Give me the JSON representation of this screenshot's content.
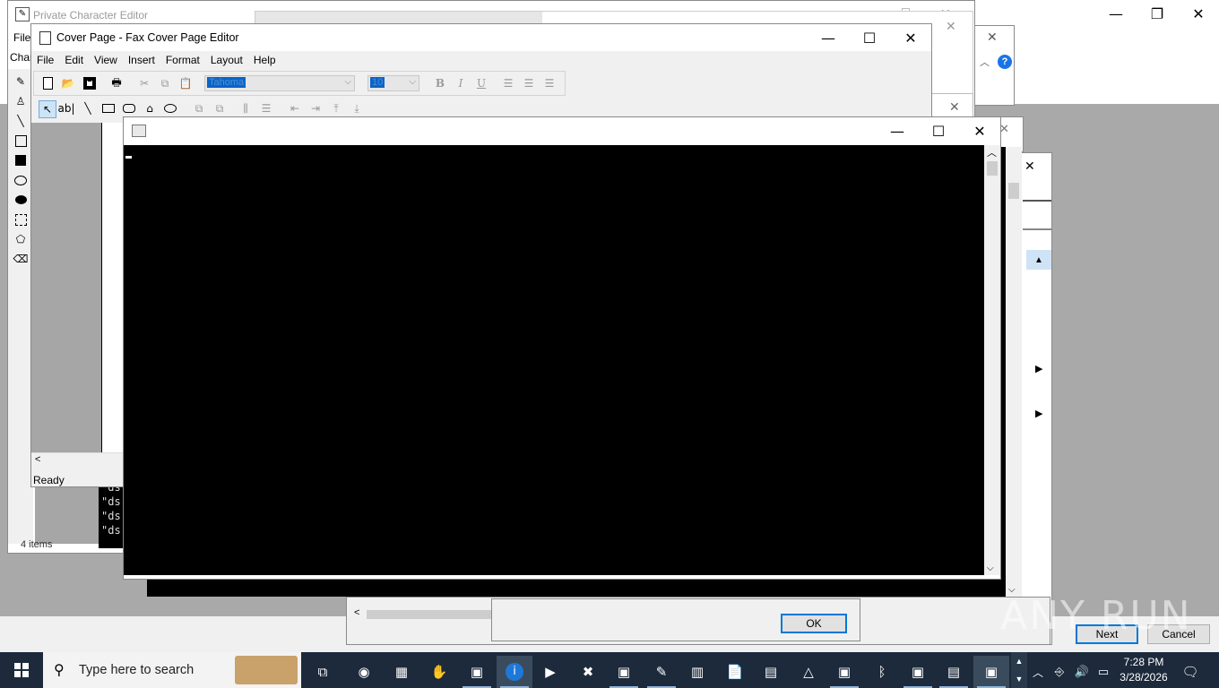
{
  "desktop": {
    "private_char_editor_title": "Private Character Editor",
    "pce_menu_file": "File",
    "pce_menu_char": "Char",
    "explorer_status": "4 items",
    "console_lines": [
      "\"ds",
      "\"ds",
      "\"ds",
      "\"ds"
    ]
  },
  "fax_editor": {
    "title": "Cover Page - Fax Cover Page Editor",
    "menu": [
      "File",
      "Edit",
      "View",
      "Insert",
      "Format",
      "Layout",
      "Help"
    ],
    "font_name": "Tahoma",
    "font_size": "10",
    "status": "Ready"
  },
  "console": {
    "title": ""
  },
  "dialog": {
    "ok_label": "OK",
    "next_label": "Next",
    "cancel_label": "Cancel"
  },
  "taskbar": {
    "search_placeholder": "Type here to search",
    "time": "7:28 PM",
    "date": "3/28/2026"
  },
  "watermark": "ANY RUN"
}
